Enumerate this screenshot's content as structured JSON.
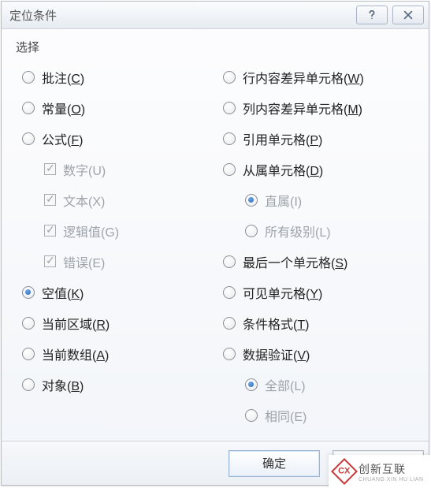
{
  "title": "定位条件",
  "group_label": "选择",
  "left": [
    {
      "label": "批注",
      "accel": "C",
      "type": "radio",
      "checked": false,
      "disabled": false,
      "indent": false
    },
    {
      "label": "常量",
      "accel": "O",
      "type": "radio",
      "checked": false,
      "disabled": false,
      "indent": false
    },
    {
      "label": "公式",
      "accel": "F",
      "type": "radio",
      "checked": false,
      "disabled": false,
      "indent": false
    },
    {
      "label": "数字",
      "accel": "U",
      "type": "check",
      "checked": true,
      "disabled": true,
      "indent": true,
      "accel_underline": false
    },
    {
      "label": "文本",
      "accel": "X",
      "type": "check",
      "checked": true,
      "disabled": true,
      "indent": true,
      "accel_underline": false
    },
    {
      "label": "逻辑值",
      "accel": "G",
      "type": "check",
      "checked": true,
      "disabled": true,
      "indent": true,
      "accel_underline": false
    },
    {
      "label": "错误",
      "accel": "E",
      "type": "check",
      "checked": true,
      "disabled": true,
      "indent": true,
      "accel_underline": false
    },
    {
      "label": "空值",
      "accel": "K",
      "type": "radio",
      "checked": true,
      "disabled": false,
      "indent": false
    },
    {
      "label": "当前区域",
      "accel": "R",
      "type": "radio",
      "checked": false,
      "disabled": false,
      "indent": false
    },
    {
      "label": "当前数组",
      "accel": "A",
      "type": "radio",
      "checked": false,
      "disabled": false,
      "indent": false
    },
    {
      "label": "对象",
      "accel": "B",
      "type": "radio",
      "checked": false,
      "disabled": false,
      "indent": false
    }
  ],
  "right": [
    {
      "label": "行内容差异单元格",
      "accel": "W",
      "type": "radio",
      "checked": false,
      "disabled": false,
      "indent": false
    },
    {
      "label": "列内容差异单元格",
      "accel": "M",
      "type": "radio",
      "checked": false,
      "disabled": false,
      "indent": false
    },
    {
      "label": "引用单元格",
      "accel": "P",
      "type": "radio",
      "checked": false,
      "disabled": false,
      "indent": false
    },
    {
      "label": "从属单元格",
      "accel": "D",
      "type": "radio",
      "checked": false,
      "disabled": false,
      "indent": false
    },
    {
      "label": "直属",
      "accel": "I",
      "type": "radio",
      "checked": true,
      "disabled": true,
      "indent": true,
      "accel_underline": false
    },
    {
      "label": "所有级别",
      "accel": "L",
      "type": "radio",
      "checked": false,
      "disabled": true,
      "indent": true,
      "accel_underline": false
    },
    {
      "label": "最后一个单元格",
      "accel": "S",
      "type": "radio",
      "checked": false,
      "disabled": false,
      "indent": false
    },
    {
      "label": "可见单元格",
      "accel": "Y",
      "type": "radio",
      "checked": false,
      "disabled": false,
      "indent": false
    },
    {
      "label": "条件格式",
      "accel": "T",
      "type": "radio",
      "checked": false,
      "disabled": false,
      "indent": false
    },
    {
      "label": "数据验证",
      "accel": "V",
      "type": "radio",
      "checked": false,
      "disabled": false,
      "indent": false
    },
    {
      "label": "全部",
      "accel": "L",
      "type": "radio",
      "checked": true,
      "disabled": true,
      "indent": true,
      "accel_underline": false
    },
    {
      "label": "相同",
      "accel": "E",
      "type": "radio",
      "checked": false,
      "disabled": true,
      "indent": true,
      "accel_underline": false
    }
  ],
  "buttons": {
    "ok": "确定",
    "cancel": ""
  },
  "watermark": {
    "logo": "CX",
    "zh": "创新互联",
    "en": "CHUANG XIN HU LIAN"
  }
}
